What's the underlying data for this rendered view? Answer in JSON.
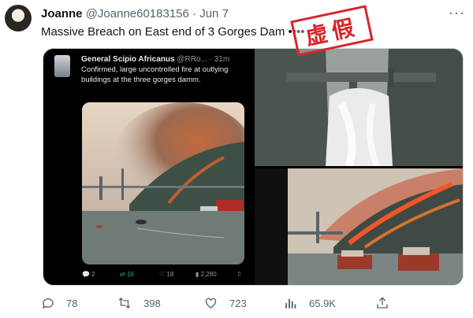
{
  "tweet": {
    "author_name": "Joanne",
    "handle": "@Joanne60183156",
    "separator": "·",
    "date": "Jun 7",
    "text": "Massive Breach on East end of 3 Gorges Dam ••••",
    "more_icon": "more-icon"
  },
  "quoted_tweet": {
    "author_name": "General Scipio Africanus",
    "handle": "@RRo...",
    "separator": "·",
    "time": "31m",
    "text": "Confirmed, large uncontrolled fire at outlying buildings at the three gorges damm.",
    "replies": "2",
    "retweets": "16",
    "likes": "18",
    "views": "2,280"
  },
  "stamp": {
    "text": "虚假",
    "color": "#d8232a"
  },
  "actions": {
    "replies": "78",
    "retweets": "398",
    "likes": "723",
    "views": "65.9K"
  },
  "colors": {
    "text_primary": "#0f1419",
    "text_secondary": "#536471",
    "retweet_green": "#00ba7c"
  }
}
